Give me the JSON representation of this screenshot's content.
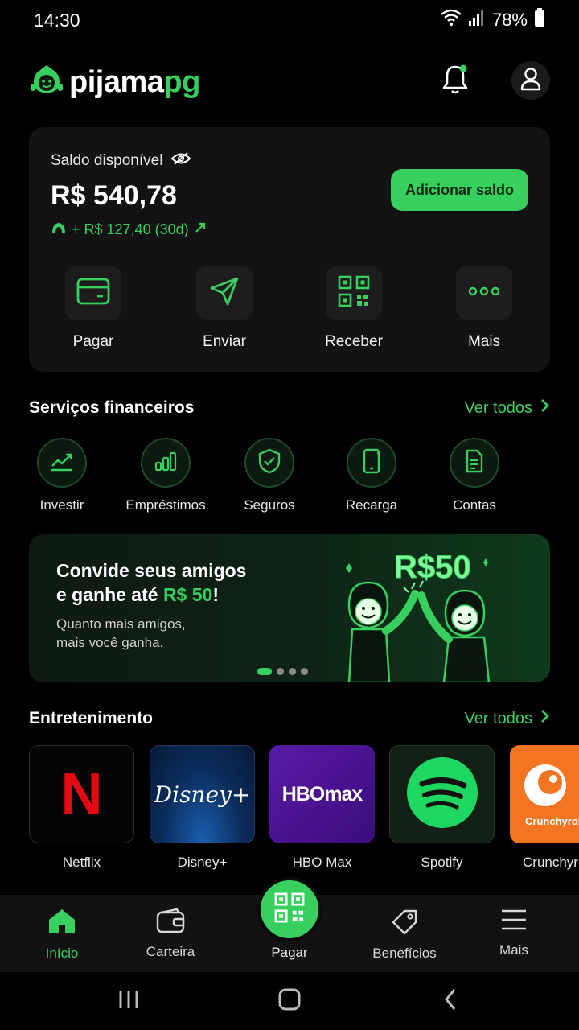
{
  "status_bar": {
    "time": "14:30",
    "battery": "78%"
  },
  "header": {
    "logo_main": "pijama",
    "logo_accent": "pg"
  },
  "balance": {
    "label": "Saldo disponível",
    "value": "R$ 540,78",
    "delta": "+ R$ 127,40 (30d)",
    "add_button": "Adicionar saldo",
    "actions": [
      {
        "label": "Pagar",
        "icon": "card-icon"
      },
      {
        "label": "Enviar",
        "icon": "send-icon"
      },
      {
        "label": "Receber",
        "icon": "qr-icon"
      },
      {
        "label": "Mais",
        "icon": "more-icon"
      }
    ]
  },
  "services": {
    "title": "Serviços financeiros",
    "see_all": "Ver todos",
    "items": [
      {
        "label": "Investir",
        "icon": "chart-icon"
      },
      {
        "label": "Empréstimos",
        "icon": "bars-icon"
      },
      {
        "label": "Seguros",
        "icon": "shield-icon"
      },
      {
        "label": "Recarga",
        "icon": "phone-icon"
      },
      {
        "label": "Contas",
        "icon": "document-icon"
      }
    ]
  },
  "promo": {
    "headline_1": "Convide seus amigos",
    "headline_2": "e ganhe até ",
    "headline_amount": "R$ 50",
    "headline_end": "!",
    "sub_1": "Quanto mais amigos,",
    "sub_2": "mais você ganha.",
    "art_amount": "R$50",
    "page_count": 4,
    "active_page": 1
  },
  "entertainment": {
    "title": "Entretenimento",
    "see_all": "Ver todos",
    "items": [
      {
        "label": "Netflix",
        "logo_text": "N"
      },
      {
        "label": "Disney+",
        "logo_text": "Disney+"
      },
      {
        "label": "HBO Max",
        "logo_text": "HBOmax"
      },
      {
        "label": "Spotify",
        "logo_text": ""
      },
      {
        "label": "Crunchyroll",
        "logo_text": "Crunchyroll"
      }
    ]
  },
  "bottom_nav": {
    "items": [
      {
        "label": "Início",
        "icon": "home-icon",
        "active": true
      },
      {
        "label": "Carteira",
        "icon": "wallet-icon",
        "active": false
      },
      {
        "label": "Pagar",
        "icon": "qr-icon",
        "active": false
      },
      {
        "label": "Benefícios",
        "icon": "tag-icon",
        "active": false
      },
      {
        "label": "Mais",
        "icon": "menu-icon",
        "active": false
      }
    ]
  },
  "colors": {
    "accent": "#37d05f",
    "background": "#000000",
    "card": "#131313"
  }
}
